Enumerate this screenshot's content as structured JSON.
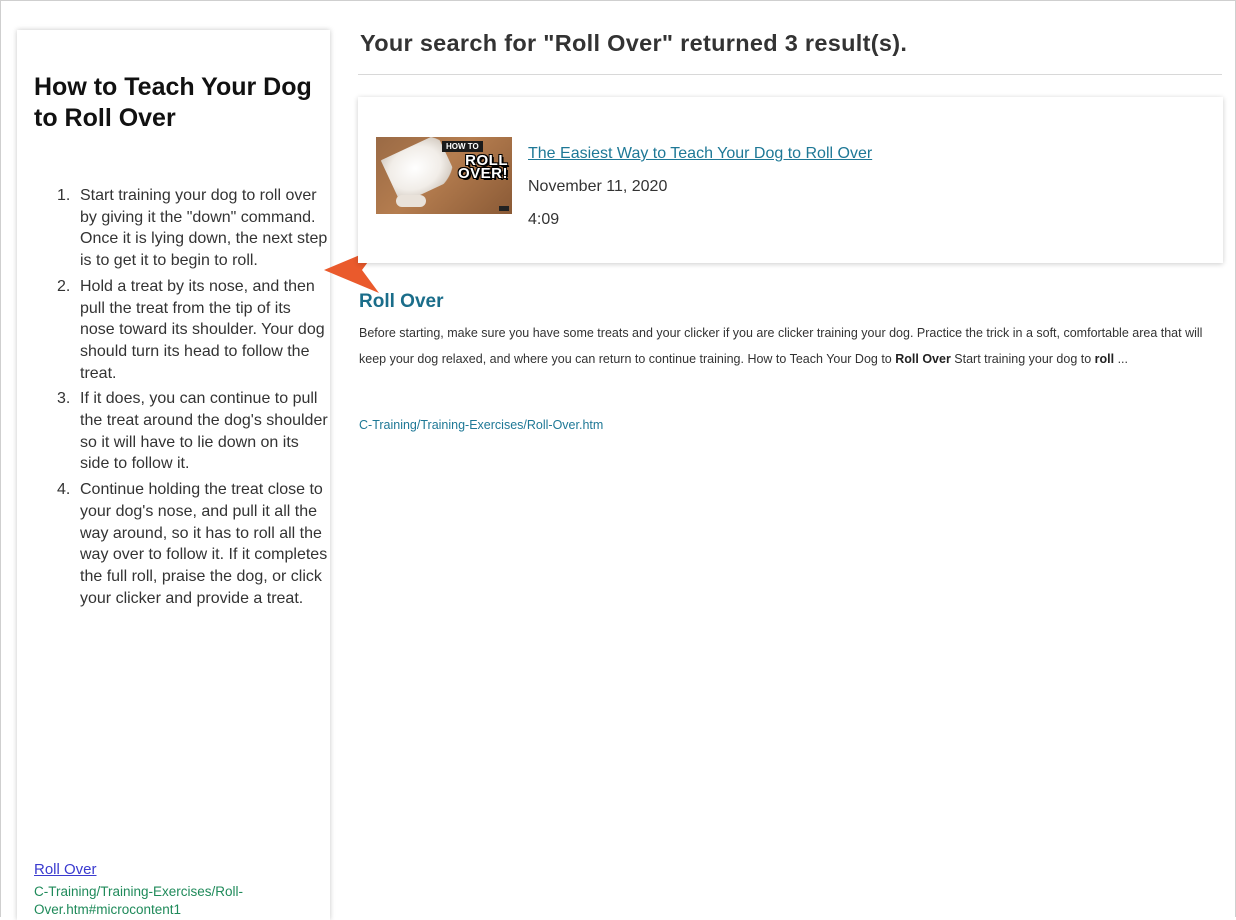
{
  "side_panel": {
    "title": "How to Teach Your Dog to Roll Over",
    "steps": [
      {
        "num": "1.",
        "text": "Start training your dog to roll over by giving it the \"down\" command. Once it is lying down, the next step is to get it to begin to roll."
      },
      {
        "num": "2.",
        "text": "Hold a treat by its nose, and then pull the treat from the tip of its nose toward its shoulder. Your dog should turn its head to follow the treat."
      },
      {
        "num": "3.",
        "text": "If it does, you can continue to pull the treat around the dog's shoulder so it will have to lie down on its side to follow it."
      },
      {
        "num": "4.",
        "text": "Continue holding the treat close to your dog's nose, and pull it all the way around, so it has to roll all the way over to follow it. If it completes the full roll, praise the dog, or click your clicker and provide a treat."
      }
    ],
    "link_label": "Roll Over",
    "path": "C-Training/Training-Exercises/Roll-Over.htm#microcontent1"
  },
  "search": {
    "heading": "Your search for \"Roll Over\" returned 3 result(s)."
  },
  "video": {
    "thumb_tag": "HOW TO",
    "thumb_text_line1": "ROLL",
    "thumb_text_line2": "OVER!",
    "title": "The Easiest Way to Teach Your Dog to Roll Over",
    "date": "November 11, 2020",
    "duration": "4:09"
  },
  "result": {
    "title": "Roll Over",
    "snippet_part1": "Before starting, make sure you have some treats and your clicker if you are clicker training your dog. Practice the trick in a soft, comfortable area that will keep your dog relaxed, and where you can return to continue training. How to Teach Your Dog to ",
    "snippet_bold1": "Roll Over",
    "snippet_part2": " Start training your dog to ",
    "snippet_bold2": "roll",
    "snippet_part3": " ...",
    "path": "C-Training/Training-Exercises/Roll-Over.htm"
  },
  "colors": {
    "arrow": "#ea5a2c",
    "link_teal": "#1e7896",
    "side_link": "#3a3acf",
    "side_path_green": "#1f8a5a"
  },
  "icons": {
    "pointer": "callout-arrow-icon"
  }
}
